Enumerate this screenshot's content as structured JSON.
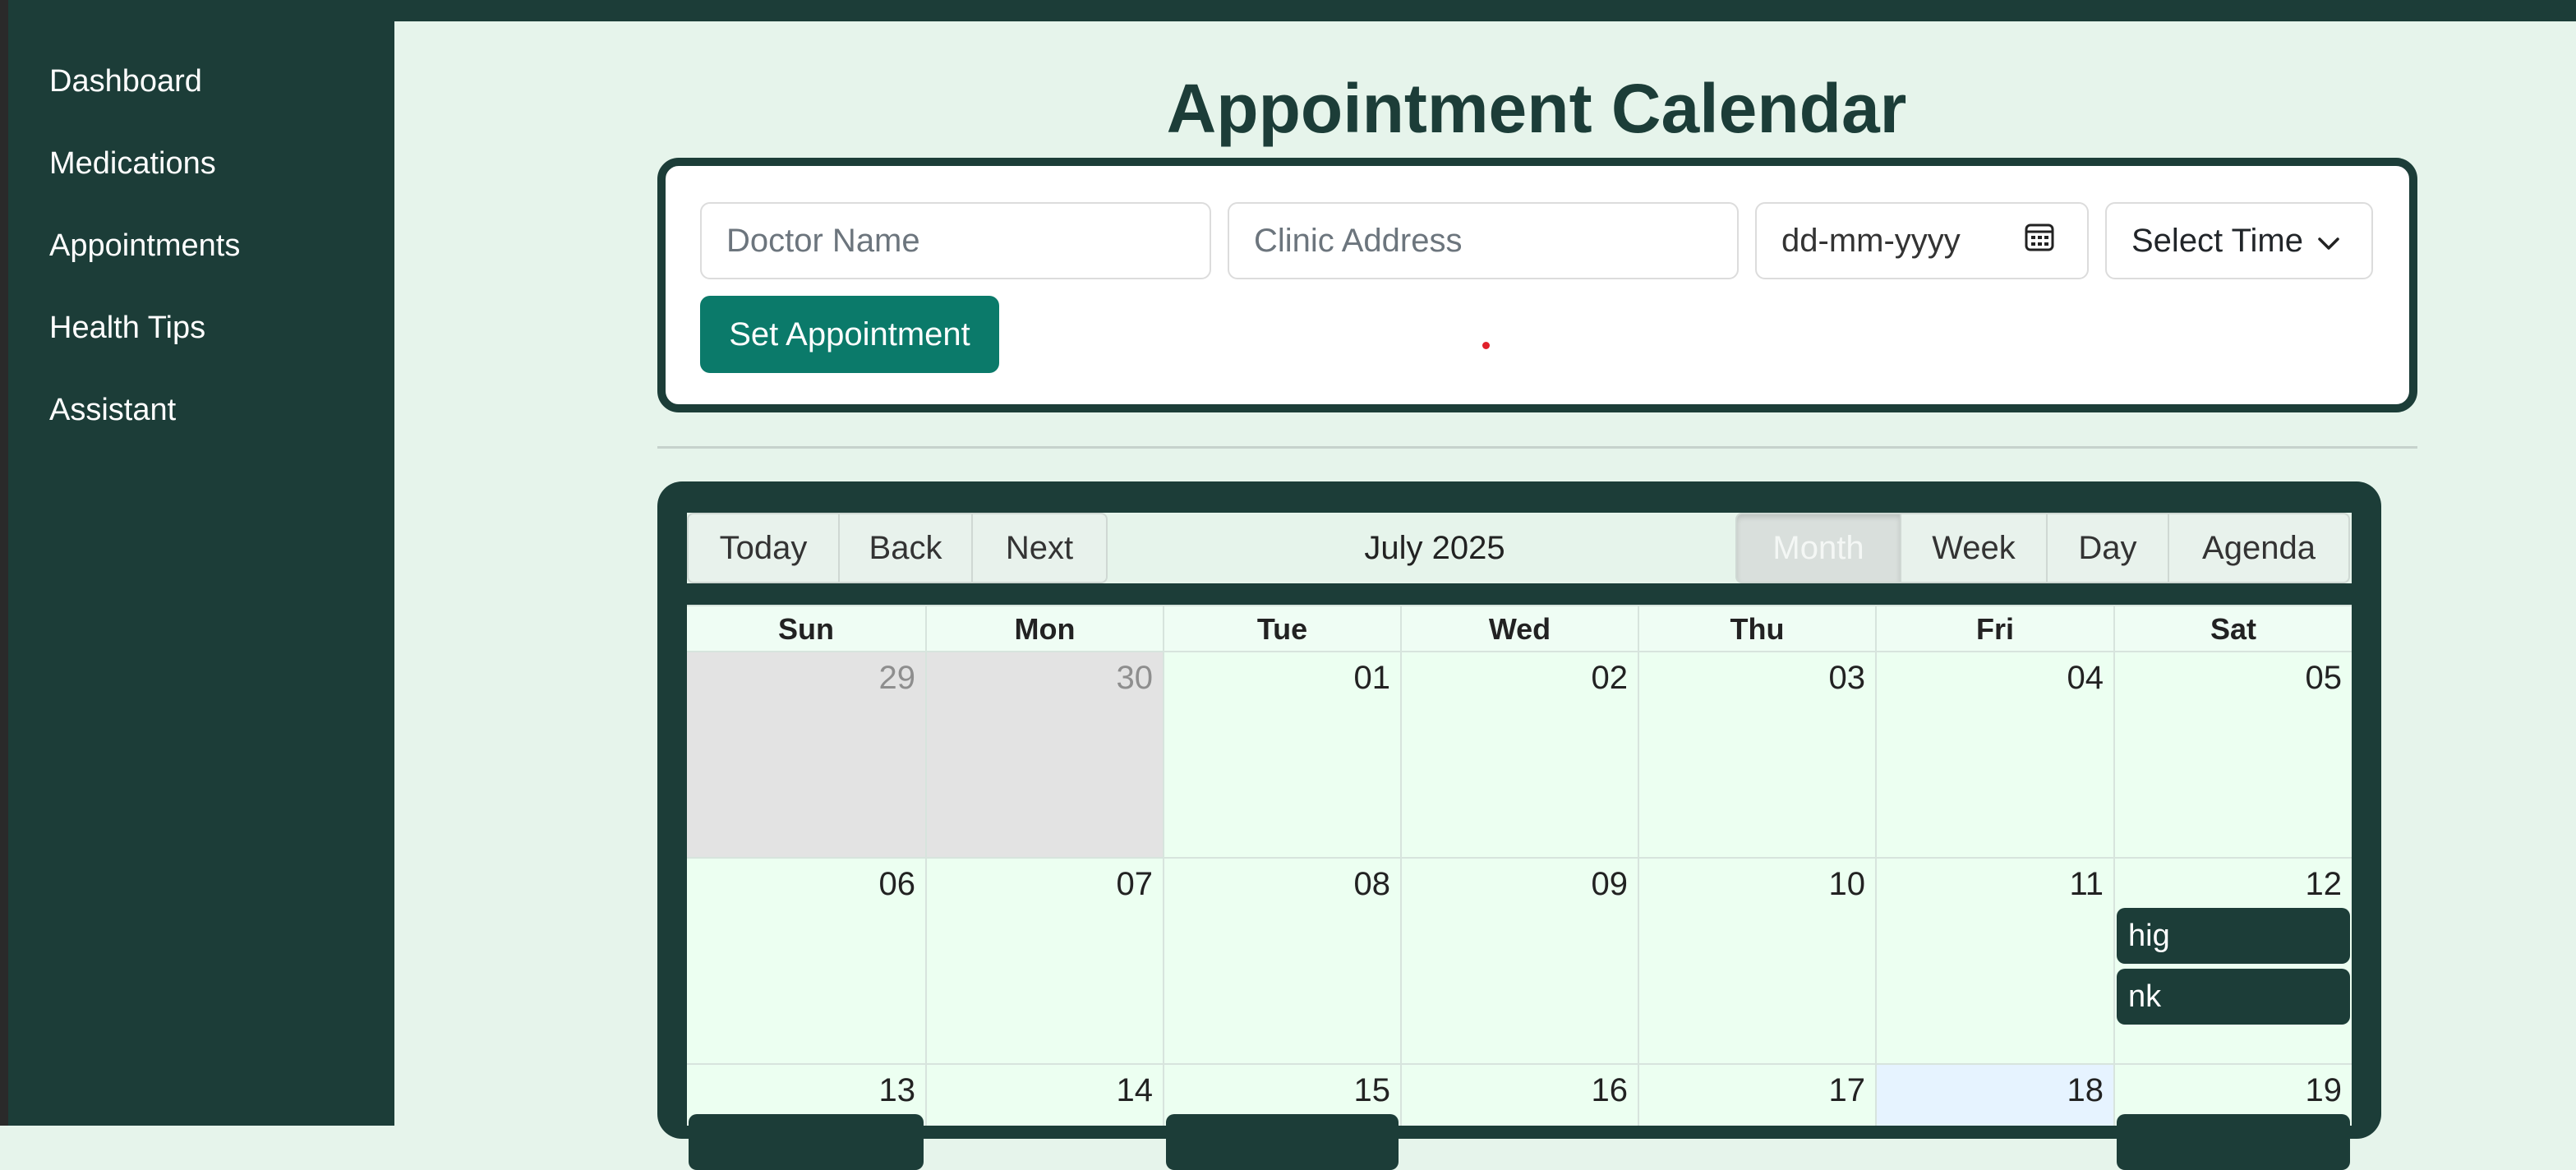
{
  "sidebar": {
    "items": [
      {
        "label": "Dashboard"
      },
      {
        "label": "Medications"
      },
      {
        "label": "Appointments"
      },
      {
        "label": "Health Tips"
      },
      {
        "label": "Assistant"
      }
    ]
  },
  "page": {
    "title": "Appointment Calendar"
  },
  "form": {
    "doctor_placeholder": "Doctor Name",
    "clinic_placeholder": "Clinic Address",
    "date_placeholder": "dd-mm-yyyy",
    "time_select": "Select Time",
    "submit_label": "Set Appointment"
  },
  "calendar": {
    "nav": {
      "today": "Today",
      "back": "Back",
      "next": "Next"
    },
    "month_label": "July 2025",
    "views": [
      {
        "label": "Month",
        "active": true
      },
      {
        "label": "Week",
        "active": false
      },
      {
        "label": "Day",
        "active": false
      },
      {
        "label": "Agenda",
        "active": false
      }
    ],
    "weekdays": [
      "Sun",
      "Mon",
      "Tue",
      "Wed",
      "Thu",
      "Fri",
      "Sat"
    ],
    "weeks": [
      [
        "29",
        "30",
        "01",
        "02",
        "03",
        "04",
        "05"
      ],
      [
        "06",
        "07",
        "08",
        "09",
        "10",
        "11",
        "12"
      ],
      [
        "13",
        "14",
        "15",
        "16",
        "17",
        "18",
        "19"
      ]
    ],
    "off_range_days": [
      "29",
      "30"
    ],
    "today": "18",
    "events": [
      {
        "day": "12",
        "title": "hig"
      },
      {
        "day": "12",
        "title": "nk"
      },
      {
        "day": "13",
        "title": ""
      },
      {
        "day": "15",
        "title": ""
      },
      {
        "day": "19",
        "title": ""
      }
    ]
  },
  "colors": {
    "primary": "#1c3d38",
    "background": "#e6f4eb",
    "accent_button": "#0b7a6a",
    "day_cell": "#ecfff1",
    "off_range_cell": "#e3e3e3",
    "today_cell": "#e6f3ff"
  },
  "icons": {
    "date_picker": "calendar-icon",
    "time_select": "chevron-down-icon"
  }
}
